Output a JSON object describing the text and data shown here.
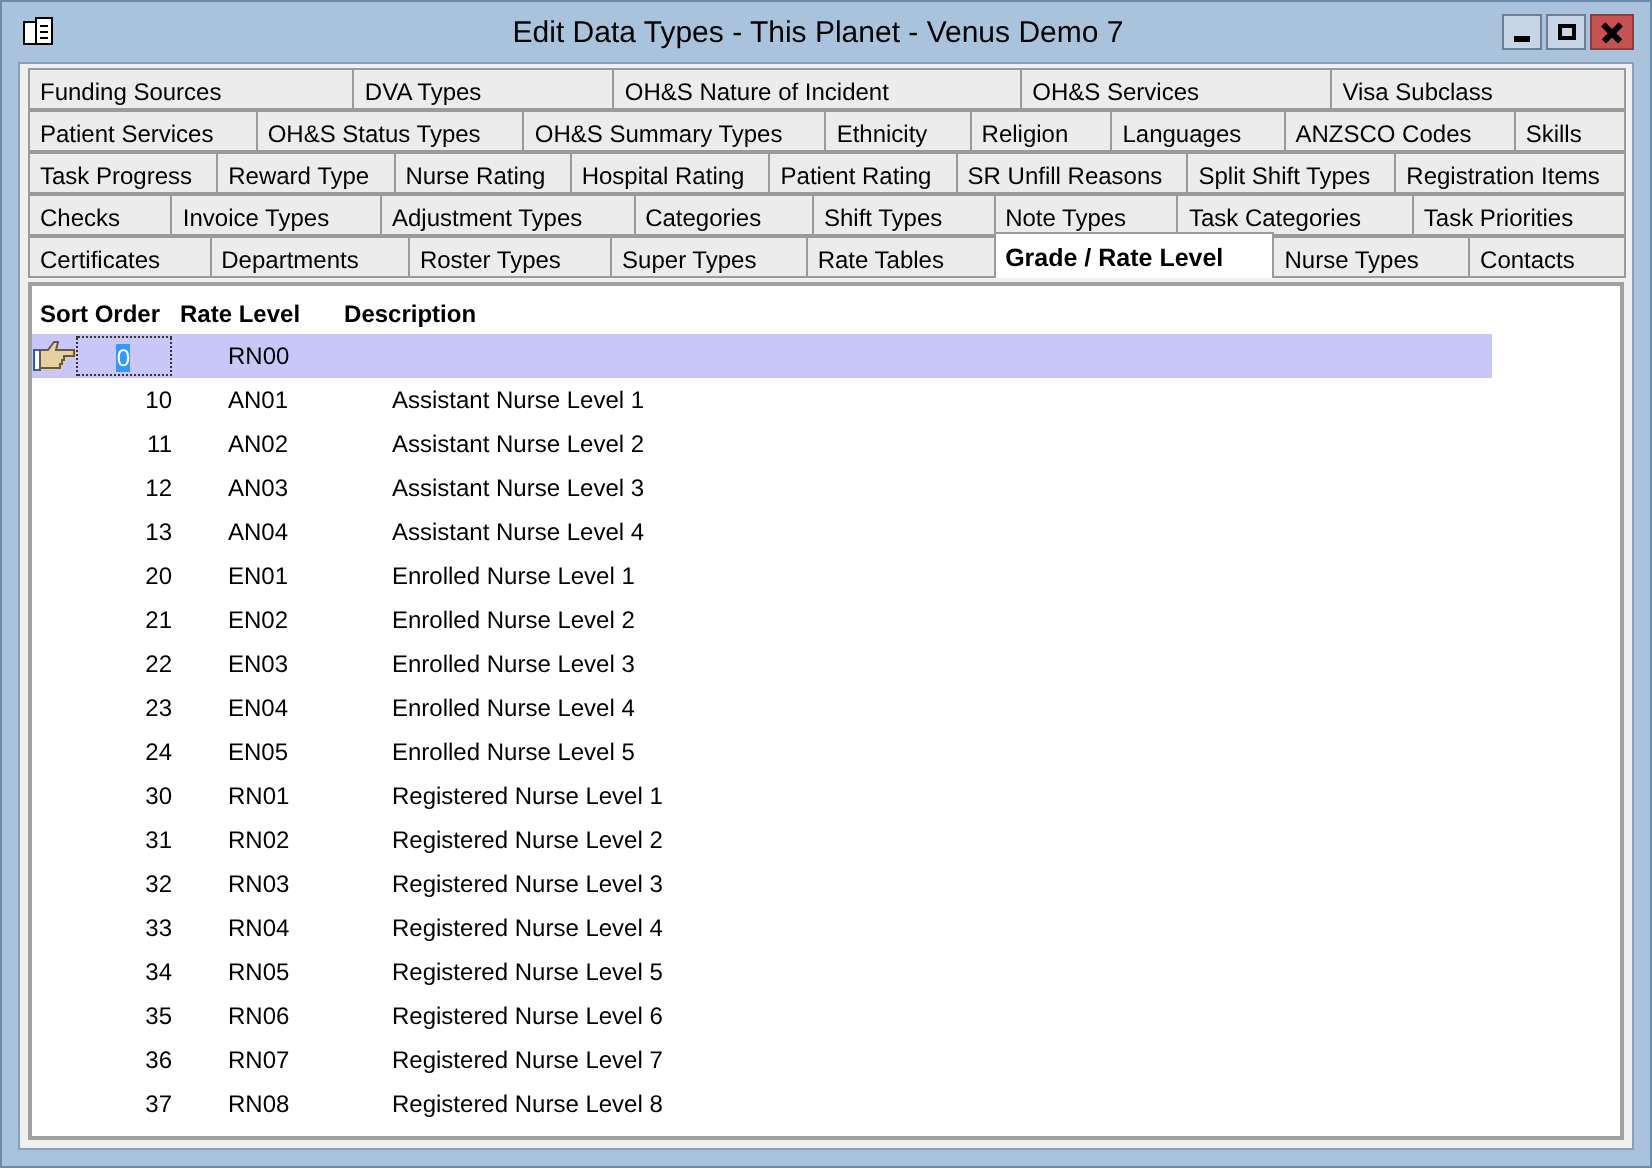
{
  "window": {
    "title": "Edit Data Types  -  This Planet - Venus Demo 7"
  },
  "tab_rows": [
    [
      {
        "label": "Funding Sources",
        "selected": false
      },
      {
        "label": "DVA Types",
        "selected": false
      },
      {
        "label": "OH&S Nature of Incident",
        "selected": false
      },
      {
        "label": "OH&S Services",
        "selected": false
      },
      {
        "label": "Visa Subclass",
        "selected": false
      }
    ],
    [
      {
        "label": "Patient Services",
        "selected": false
      },
      {
        "label": "OH&S Status Types",
        "selected": false
      },
      {
        "label": "OH&S Summary Types",
        "selected": false
      },
      {
        "label": "Ethnicity",
        "selected": false
      },
      {
        "label": "Religion",
        "selected": false
      },
      {
        "label": "Languages",
        "selected": false
      },
      {
        "label": "ANZSCO Codes",
        "selected": false
      },
      {
        "label": "Skills",
        "selected": false
      }
    ],
    [
      {
        "label": "Task Progress",
        "selected": false
      },
      {
        "label": "Reward Type",
        "selected": false
      },
      {
        "label": "Nurse Rating",
        "selected": false
      },
      {
        "label": "Hospital Rating",
        "selected": false
      },
      {
        "label": "Patient Rating",
        "selected": false
      },
      {
        "label": "SR Unfill Reasons",
        "selected": false
      },
      {
        "label": "Split Shift Types",
        "selected": false
      },
      {
        "label": "Registration Items",
        "selected": false
      }
    ],
    [
      {
        "label": "Checks",
        "selected": false
      },
      {
        "label": "Invoice Types",
        "selected": false
      },
      {
        "label": "Adjustment Types",
        "selected": false
      },
      {
        "label": "Categories",
        "selected": false
      },
      {
        "label": "Shift Types",
        "selected": false
      },
      {
        "label": "Note Types",
        "selected": false
      },
      {
        "label": "Task Categories",
        "selected": false
      },
      {
        "label": "Task Priorities",
        "selected": false
      }
    ],
    [
      {
        "label": "Certificates",
        "selected": false
      },
      {
        "label": "Departments",
        "selected": false
      },
      {
        "label": "Roster Types",
        "selected": false
      },
      {
        "label": "Super Types",
        "selected": false
      },
      {
        "label": "Rate Tables",
        "selected": false
      },
      {
        "label": "Grade / Rate Level",
        "selected": true
      },
      {
        "label": "Nurse Types",
        "selected": false
      },
      {
        "label": "Contacts",
        "selected": false
      }
    ]
  ],
  "table": {
    "columns": [
      "Sort Order",
      "Rate Level",
      "Description"
    ],
    "rows": [
      {
        "sort_order": "0",
        "rate_level": "RN00",
        "selected": true
      },
      {
        "sort_order": "10",
        "rate_level": "AN01",
        "description": "Assistant Nurse Level 1",
        "selected": false
      },
      {
        "sort_order": "11",
        "rate_level": "AN02",
        "description": "Assistant Nurse Level 2",
        "selected": false
      },
      {
        "sort_order": "12",
        "rate_level": "AN03",
        "description": "Assistant Nurse Level 3",
        "selected": false
      },
      {
        "sort_order": "13",
        "rate_level": "AN04",
        "description": "Assistant Nurse Level 4",
        "selected": false
      },
      {
        "sort_order": "20",
        "rate_level": "EN01",
        "description": "Enrolled Nurse Level 1",
        "selected": false
      },
      {
        "sort_order": "21",
        "rate_level": "EN02",
        "description": "Enrolled Nurse Level 2",
        "selected": false
      },
      {
        "sort_order": "22",
        "rate_level": "EN03",
        "description": "Enrolled Nurse Level 3",
        "selected": false
      },
      {
        "sort_order": "23",
        "rate_level": "EN04",
        "description": "Enrolled Nurse Level 4",
        "selected": false
      },
      {
        "sort_order": "24",
        "rate_level": "EN05",
        "description": "Enrolled Nurse Level 5",
        "selected": false
      },
      {
        "sort_order": "30",
        "rate_level": "RN01",
        "description": "Registered Nurse Level 1",
        "selected": false
      },
      {
        "sort_order": "31",
        "rate_level": "RN02",
        "description": "Registered Nurse Level 2",
        "selected": false
      },
      {
        "sort_order": "32",
        "rate_level": "RN03",
        "description": "Registered Nurse Level 3",
        "selected": false
      },
      {
        "sort_order": "33",
        "rate_level": "RN04",
        "description": "Registered Nurse Level 4",
        "selected": false
      },
      {
        "sort_order": "34",
        "rate_level": "RN05",
        "description": "Registered Nurse Level 5",
        "selected": false
      },
      {
        "sort_order": "35",
        "rate_level": "RN06",
        "description": "Registered Nurse Level 6",
        "selected": false
      },
      {
        "sort_order": "36",
        "rate_level": "RN07",
        "description": "Registered Nurse Level 7",
        "selected": false
      },
      {
        "sort_order": "37",
        "rate_level": "RN08",
        "description": "Registered Nurse Level 8",
        "selected": false
      }
    ]
  }
}
